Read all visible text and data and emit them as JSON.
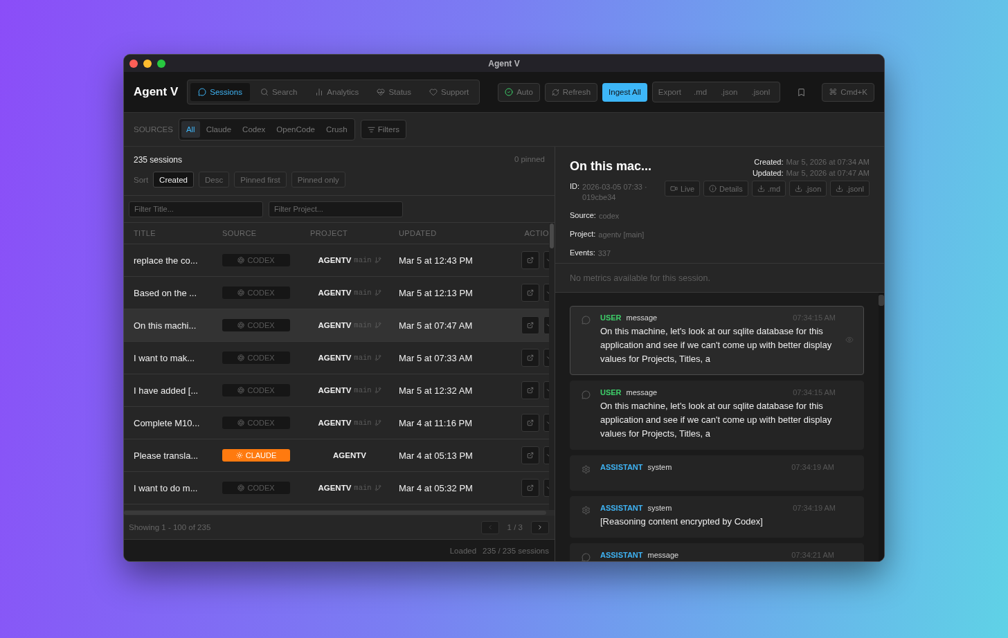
{
  "window": {
    "title": "Agent V"
  },
  "app": {
    "logo": "Agent V"
  },
  "nav": [
    {
      "label": "Sessions",
      "selected": true
    },
    {
      "label": "Search",
      "selected": false
    },
    {
      "label": "Analytics",
      "selected": false
    },
    {
      "label": "Status",
      "selected": false
    },
    {
      "label": "Support",
      "selected": false
    }
  ],
  "toolbar": {
    "auto": {
      "label": "Auto",
      "on": true
    },
    "refresh": "Refresh",
    "ingest": "Ingest All",
    "export": {
      "label": "Export",
      "formats": [
        ".md",
        ".json",
        ".jsonl"
      ]
    },
    "command": {
      "key": "⌘",
      "label": "Cmd+K"
    }
  },
  "sources": {
    "label": "SOURCES",
    "items": [
      {
        "label": "All",
        "selected": true
      },
      {
        "label": "Claude",
        "selected": false
      },
      {
        "label": "Codex",
        "selected": false
      },
      {
        "label": "OpenCode",
        "selected": false
      },
      {
        "label": "Crush",
        "selected": false
      }
    ],
    "filters": "Filters"
  },
  "list": {
    "count": "235 sessions",
    "pinned": "0 pinned",
    "sort_label": "Sort",
    "sort_options": [
      {
        "label": "Created",
        "selected": true
      },
      {
        "label": "Desc",
        "selected": false
      },
      {
        "label": "Pinned first",
        "selected": false
      },
      {
        "label": "Pinned only",
        "selected": false
      }
    ]
  },
  "filters": {
    "title_placeholder": "Filter Title...",
    "project_placeholder": "Filter Project..."
  },
  "table": {
    "columns": [
      "TITLE",
      "SOURCE",
      "PROJECT",
      "UPDATED",
      "ACTIO"
    ],
    "rows": [
      {
        "title": "replace the co...",
        "source": "CODEX",
        "kind": "codex",
        "project": "AGENTV",
        "branch": "main",
        "updated": "Mar 5 at 12:43 PM",
        "selected": false
      },
      {
        "title": "Based on the ...",
        "source": "CODEX",
        "kind": "codex",
        "project": "AGENTV",
        "branch": "main",
        "updated": "Mar 5 at 12:13 PM",
        "selected": false
      },
      {
        "title": "On this machi...",
        "source": "CODEX",
        "kind": "codex",
        "project": "AGENTV",
        "branch": "main",
        "updated": "Mar 5 at 07:47 AM",
        "selected": true
      },
      {
        "title": "I want to mak...",
        "source": "CODEX",
        "kind": "codex",
        "project": "AGENTV",
        "branch": "main",
        "updated": "Mar 5 at 07:33 AM",
        "selected": false
      },
      {
        "title": "I have added [...",
        "source": "CODEX",
        "kind": "codex",
        "project": "AGENTV",
        "branch": "main",
        "updated": "Mar 5 at 12:32 AM",
        "selected": false
      },
      {
        "title": "Complete M10...",
        "source": "CODEX",
        "kind": "codex",
        "project": "AGENTV",
        "branch": "main",
        "updated": "Mar 4 at 11:16 PM",
        "selected": false
      },
      {
        "title": "Please transla...",
        "source": "CLAUDE",
        "kind": "claude",
        "project": "AGENTV",
        "updated": "Mar 4 at 05:13 PM",
        "selected": false
      },
      {
        "title": "I want to do m...",
        "source": "CODEX",
        "kind": "codex",
        "project": "AGENTV",
        "branch": "main",
        "updated": "Mar 4 at 05:32 PM",
        "selected": false
      }
    ]
  },
  "pager": {
    "showing": "Showing 1 - 100 of 235",
    "page": "1 / 3"
  },
  "status_bar": {
    "label": "Loaded",
    "value": "235 / 235 sessions"
  },
  "detail": {
    "title": "On this mac...",
    "created_label": "Created:",
    "created": "Mar 5, 2026 at 07:34 AM",
    "updated_label": "Updated:",
    "updated": "Mar 5, 2026 at 07:47 AM",
    "fields": [
      {
        "label": "ID:",
        "value": "2026-03-05 07:33 · 019cbe34"
      },
      {
        "label": "Source:",
        "value": "codex"
      },
      {
        "label": "Project:",
        "value": "agentv [main]"
      },
      {
        "label": "Events:",
        "value": "337"
      }
    ],
    "actions": [
      {
        "label": "Live",
        "kind": "live"
      },
      {
        "label": "Details",
        "kind": "details"
      },
      {
        "label": ".md",
        "kind": "download"
      },
      {
        "label": ".json",
        "kind": "download"
      },
      {
        "label": ".jsonl",
        "kind": "download"
      }
    ],
    "metrics": "No metrics available for this session."
  },
  "messages": [
    {
      "kind": "user_message",
      "role": "USER",
      "type": "message",
      "time": "07:34:15 AM",
      "text": "On this machine, let's look at our sqlite database for this application and see if we can't come up with better display values for Projects, Titles, a",
      "selected": true
    },
    {
      "kind": "user_message",
      "role": "USER",
      "type": "message",
      "time": "07:34:15 AM",
      "text": "On this machine, let's look at our sqlite database for this application and see if we can't come up with better display values for Projects, Titles, a",
      "selected": false
    },
    {
      "kind": "assistant_system",
      "role": "ASSISTANT",
      "type": "system",
      "time": "07:34:19 AM",
      "selected": false
    },
    {
      "kind": "assistant_system",
      "role": "ASSISTANT",
      "type": "system",
      "time": "07:34:19 AM",
      "text": "[Reasoning content encrypted by Codex]",
      "selected": false
    },
    {
      "kind": "assistant_message",
      "role": "ASSISTANT",
      "type": "message",
      "time": "07:34:21 AM",
      "selected": false
    }
  ]
}
